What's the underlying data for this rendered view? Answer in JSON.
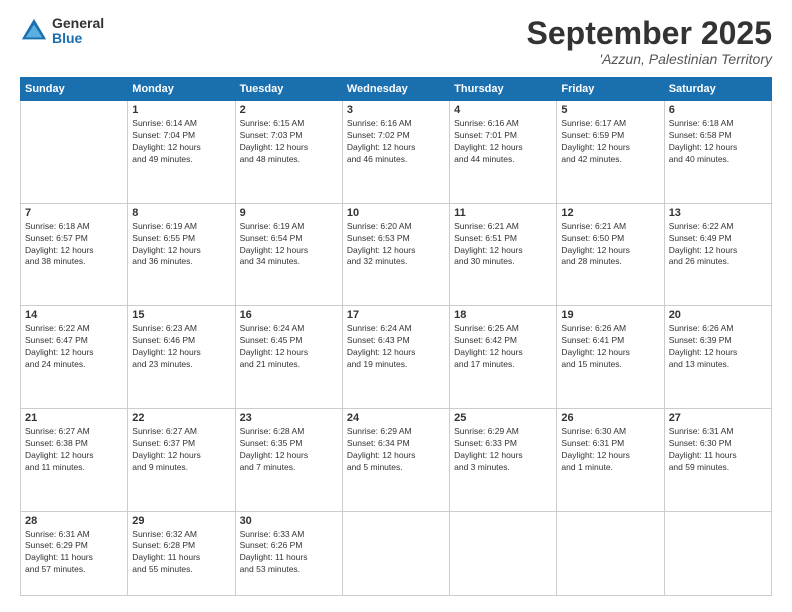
{
  "logo": {
    "general": "General",
    "blue": "Blue"
  },
  "header": {
    "month": "September 2025",
    "location": "'Azzun, Palestinian Territory"
  },
  "weekdays": [
    "Sunday",
    "Monday",
    "Tuesday",
    "Wednesday",
    "Thursday",
    "Friday",
    "Saturday"
  ],
  "weeks": [
    [
      {
        "day": "",
        "content": ""
      },
      {
        "day": "1",
        "content": "Sunrise: 6:14 AM\nSunset: 7:04 PM\nDaylight: 12 hours\nand 49 minutes."
      },
      {
        "day": "2",
        "content": "Sunrise: 6:15 AM\nSunset: 7:03 PM\nDaylight: 12 hours\nand 48 minutes."
      },
      {
        "day": "3",
        "content": "Sunrise: 6:16 AM\nSunset: 7:02 PM\nDaylight: 12 hours\nand 46 minutes."
      },
      {
        "day": "4",
        "content": "Sunrise: 6:16 AM\nSunset: 7:01 PM\nDaylight: 12 hours\nand 44 minutes."
      },
      {
        "day": "5",
        "content": "Sunrise: 6:17 AM\nSunset: 6:59 PM\nDaylight: 12 hours\nand 42 minutes."
      },
      {
        "day": "6",
        "content": "Sunrise: 6:18 AM\nSunset: 6:58 PM\nDaylight: 12 hours\nand 40 minutes."
      }
    ],
    [
      {
        "day": "7",
        "content": "Sunrise: 6:18 AM\nSunset: 6:57 PM\nDaylight: 12 hours\nand 38 minutes."
      },
      {
        "day": "8",
        "content": "Sunrise: 6:19 AM\nSunset: 6:55 PM\nDaylight: 12 hours\nand 36 minutes."
      },
      {
        "day": "9",
        "content": "Sunrise: 6:19 AM\nSunset: 6:54 PM\nDaylight: 12 hours\nand 34 minutes."
      },
      {
        "day": "10",
        "content": "Sunrise: 6:20 AM\nSunset: 6:53 PM\nDaylight: 12 hours\nand 32 minutes."
      },
      {
        "day": "11",
        "content": "Sunrise: 6:21 AM\nSunset: 6:51 PM\nDaylight: 12 hours\nand 30 minutes."
      },
      {
        "day": "12",
        "content": "Sunrise: 6:21 AM\nSunset: 6:50 PM\nDaylight: 12 hours\nand 28 minutes."
      },
      {
        "day": "13",
        "content": "Sunrise: 6:22 AM\nSunset: 6:49 PM\nDaylight: 12 hours\nand 26 minutes."
      }
    ],
    [
      {
        "day": "14",
        "content": "Sunrise: 6:22 AM\nSunset: 6:47 PM\nDaylight: 12 hours\nand 24 minutes."
      },
      {
        "day": "15",
        "content": "Sunrise: 6:23 AM\nSunset: 6:46 PM\nDaylight: 12 hours\nand 23 minutes."
      },
      {
        "day": "16",
        "content": "Sunrise: 6:24 AM\nSunset: 6:45 PM\nDaylight: 12 hours\nand 21 minutes."
      },
      {
        "day": "17",
        "content": "Sunrise: 6:24 AM\nSunset: 6:43 PM\nDaylight: 12 hours\nand 19 minutes."
      },
      {
        "day": "18",
        "content": "Sunrise: 6:25 AM\nSunset: 6:42 PM\nDaylight: 12 hours\nand 17 minutes."
      },
      {
        "day": "19",
        "content": "Sunrise: 6:26 AM\nSunset: 6:41 PM\nDaylight: 12 hours\nand 15 minutes."
      },
      {
        "day": "20",
        "content": "Sunrise: 6:26 AM\nSunset: 6:39 PM\nDaylight: 12 hours\nand 13 minutes."
      }
    ],
    [
      {
        "day": "21",
        "content": "Sunrise: 6:27 AM\nSunset: 6:38 PM\nDaylight: 12 hours\nand 11 minutes."
      },
      {
        "day": "22",
        "content": "Sunrise: 6:27 AM\nSunset: 6:37 PM\nDaylight: 12 hours\nand 9 minutes."
      },
      {
        "day": "23",
        "content": "Sunrise: 6:28 AM\nSunset: 6:35 PM\nDaylight: 12 hours\nand 7 minutes."
      },
      {
        "day": "24",
        "content": "Sunrise: 6:29 AM\nSunset: 6:34 PM\nDaylight: 12 hours\nand 5 minutes."
      },
      {
        "day": "25",
        "content": "Sunrise: 6:29 AM\nSunset: 6:33 PM\nDaylight: 12 hours\nand 3 minutes."
      },
      {
        "day": "26",
        "content": "Sunrise: 6:30 AM\nSunset: 6:31 PM\nDaylight: 12 hours\nand 1 minute."
      },
      {
        "day": "27",
        "content": "Sunrise: 6:31 AM\nSunset: 6:30 PM\nDaylight: 11 hours\nand 59 minutes."
      }
    ],
    [
      {
        "day": "28",
        "content": "Sunrise: 6:31 AM\nSunset: 6:29 PM\nDaylight: 11 hours\nand 57 minutes."
      },
      {
        "day": "29",
        "content": "Sunrise: 6:32 AM\nSunset: 6:28 PM\nDaylight: 11 hours\nand 55 minutes."
      },
      {
        "day": "30",
        "content": "Sunrise: 6:33 AM\nSunset: 6:26 PM\nDaylight: 11 hours\nand 53 minutes."
      },
      {
        "day": "",
        "content": ""
      },
      {
        "day": "",
        "content": ""
      },
      {
        "day": "",
        "content": ""
      },
      {
        "day": "",
        "content": ""
      }
    ]
  ]
}
